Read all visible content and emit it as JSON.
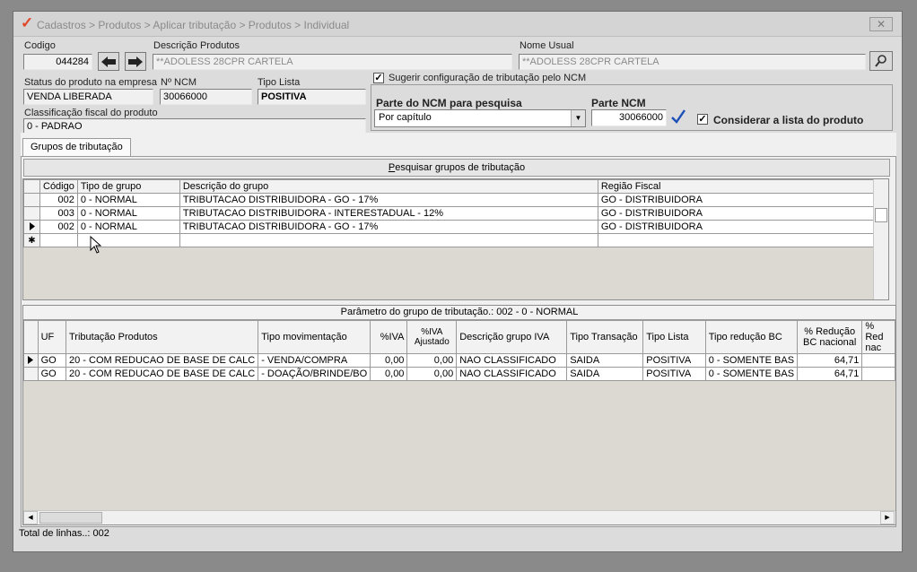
{
  "window": {
    "title": "Cadastros > Produtos > Aplicar tributação > Produtos > Individual",
    "close_glyph": "✕"
  },
  "header": {
    "codigo_label": "Codigo",
    "codigo_value": "044284",
    "descricao_label": "Descrição  Produtos",
    "descricao_value": "**ADOLESS 28CPR CARTELA",
    "nome_usual_label": "Nome Usual",
    "nome_usual_value": "**ADOLESS 28CPR CARTELA",
    "status_label": "Status do produto na empresa",
    "status_value": "VENDA LIBERADA",
    "ncm_label": "Nº NCM",
    "ncm_value": "30066000",
    "tipo_lista_label": "Tipo Lista",
    "tipo_lista_value": "POSITIVA",
    "classificacao_label": "Classificação fiscal do produto",
    "classificacao_value": "0 - PADRAO",
    "sugerir_label": "Sugerir configuração de tributação pelo NCM",
    "parte_ncm_pesquisa_label": "Parte do NCM para pesquisa",
    "parte_ncm_pesquisa_value": "Por capítulo",
    "parte_ncm_label": "Parte NCM",
    "parte_ncm_value": "30066000",
    "considerar_label": "Considerar a lista do produto"
  },
  "tabs": [
    {
      "label": "Grupos de tributação"
    }
  ],
  "grupos": {
    "search_button_prefix": "",
    "search_button_underlined": "P",
    "search_button_rest": "esquisar grupos de tributação",
    "columns": [
      "Código",
      "Tipo de grupo",
      "Descrição do grupo",
      "Região Fiscal"
    ],
    "rows": [
      {
        "codigo": "002",
        "tipo": "0 - NORMAL",
        "descricao": "TRIBUTACAO DISTRIBUIDORA - GO - 17%",
        "regiao": "GO - DISTRIBUIDORA"
      },
      {
        "codigo": "003",
        "tipo": "0 - NORMAL",
        "descricao": "TRIBUTACAO DISTRIBUIDORA - INTERESTADUAL - 12%",
        "regiao": "GO - DISTRIBUIDORA"
      },
      {
        "codigo": "002",
        "tipo": "0 - NORMAL",
        "descricao": "TRIBUTACAO DISTRIBUIDORA - GO - 17%",
        "regiao": "GO - DISTRIBUIDORA"
      }
    ],
    "new_row_marker": "✱"
  },
  "parametros": {
    "caption": "Parâmetro do grupo de tributação.: 002 - 0 - NORMAL",
    "columns": [
      "UF",
      "Tributação Produtos",
      "Tipo movimentação",
      "%IVA",
      "%IVA Ajustado",
      "Descrição grupo IVA",
      "Tipo Transação",
      "Tipo Lista",
      "Tipo redução BC",
      "% Redução BC nacional",
      "% Red nac"
    ],
    "rows": [
      {
        "uf": "GO",
        "tributacao": "20 - COM REDUCAO DE BASE DE CALC",
        "movimentacao": "- VENDA/COMPRA",
        "iva": "0,00",
        "iva_ajustado": "0,00",
        "grupo_iva": "NAO CLASSIFICADO",
        "transacao": "SAIDA",
        "lista": "POSITIVA",
        "reducao": "0 - SOMENTE BAS",
        "reducao_nacional": "64,71"
      },
      {
        "uf": "GO",
        "tributacao": "20 - COM REDUCAO DE BASE DE CALC",
        "movimentacao": "- DOAÇÃO/BRINDE/BO",
        "iva": "0,00",
        "iva_ajustado": "0,00",
        "grupo_iva": "NAO CLASSIFICADO",
        "transacao": "SAIDA",
        "lista": "POSITIVA",
        "reducao": "0 - SOMENTE BAS",
        "reducao_nacional": "64,71"
      }
    ]
  },
  "status": {
    "total_linhas": "Total de linhas..: 002"
  }
}
